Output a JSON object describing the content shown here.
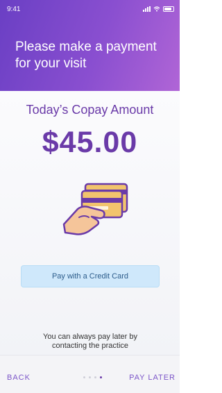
{
  "status_bar": {
    "time": "9:41"
  },
  "header": {
    "title": "Please make a payment for your visit"
  },
  "main": {
    "copay_label": "Today’s Copay Amount",
    "amount": "$45.00",
    "illustration_icon": "credit-card-in-hand-icon",
    "pay_button_label": "Pay with a Credit Card",
    "note": "You can always pay later by contacting the practice"
  },
  "footer": {
    "back_label": "BACK",
    "pay_later_label": "PAY LATER",
    "page_indicator": {
      "total": 4,
      "current": 4
    }
  },
  "colors": {
    "header_gradient_start": "#6a3fc4",
    "header_gradient_end": "#b065d6",
    "accent_purple": "#6a3aa8",
    "button_bg": "#cfe8fb",
    "button_text": "#2b5b8a"
  }
}
